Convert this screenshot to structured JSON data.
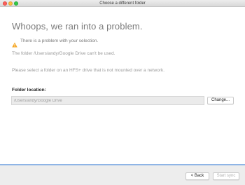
{
  "window": {
    "title": "Choose a different folder"
  },
  "main": {
    "heading": "Whoops, we ran into a problem.",
    "warning": {
      "icon": "warning-icon",
      "text": "There is a problem with your selection."
    },
    "message": "The folder /Users/andy/Google Drive can't be used.",
    "instruction": "Please select a folder on an HFS+ drive that is not mounted over a network."
  },
  "location": {
    "label": "Folder location:",
    "value": "/Users/andy/Google Drive",
    "change_label": "Change..."
  },
  "footer": {
    "back_label": "< Back",
    "start_label": "Start sync"
  },
  "colors": {
    "accent": "#8fb5e6",
    "warning": "#f5a623"
  }
}
